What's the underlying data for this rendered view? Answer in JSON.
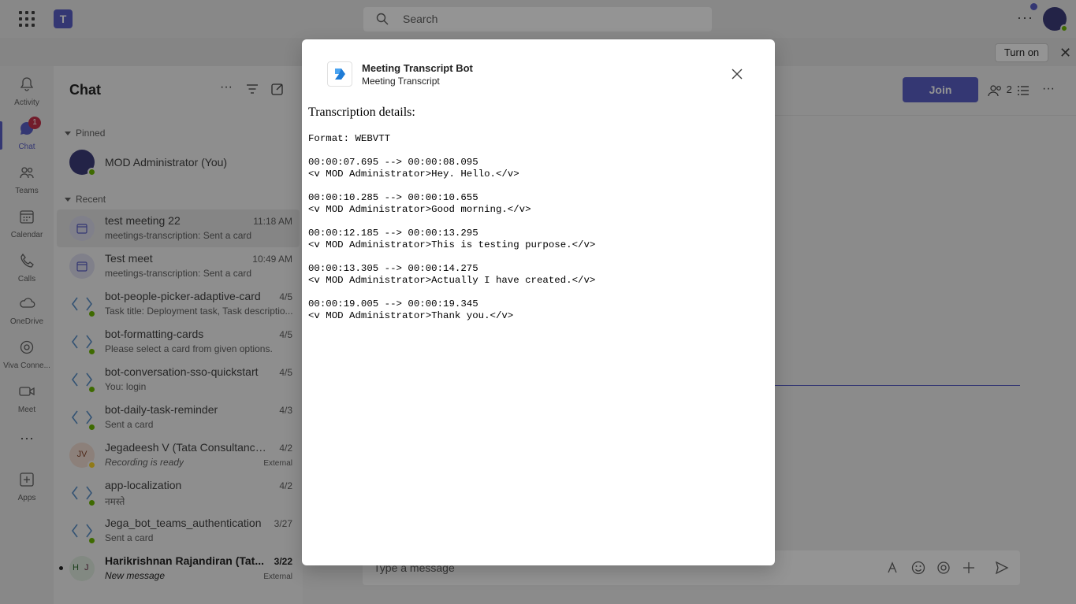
{
  "topbar": {
    "search_placeholder": "Search"
  },
  "banner": {
    "turn_on_label": "Turn on"
  },
  "rail": {
    "items": [
      {
        "label": "Activity",
        "icon": "bell-icon"
      },
      {
        "label": "Chat",
        "icon": "chat-icon",
        "badge": "1"
      },
      {
        "label": "Teams",
        "icon": "teams-icon"
      },
      {
        "label": "Calendar",
        "icon": "calendar-icon"
      },
      {
        "label": "Calls",
        "icon": "phone-icon"
      },
      {
        "label": "OneDrive",
        "icon": "cloud-icon"
      },
      {
        "label": "Viva Conne...",
        "icon": "viva-icon"
      },
      {
        "label": "Meet",
        "icon": "video-icon"
      },
      {
        "label": "Apps",
        "icon": "apps-icon"
      }
    ]
  },
  "chatlist": {
    "title": "Chat",
    "pinned_label": "Pinned",
    "recent_label": "Recent",
    "pinned": [
      {
        "name": "MOD Administrator (You)"
      }
    ],
    "recent": [
      {
        "name": "test meeting 22",
        "time": "11:18 AM",
        "preview": "meetings-transcription: Sent a card"
      },
      {
        "name": "Test meet",
        "time": "10:49 AM",
        "preview": "meetings-transcription: Sent a card"
      },
      {
        "name": "bot-people-picker-adaptive-card",
        "time": "4/5",
        "preview": "Task title: Deployment task, Task descriptio..."
      },
      {
        "name": "bot-formatting-cards",
        "time": "4/5",
        "preview": "Please select a card from given options."
      },
      {
        "name": "bot-conversation-sso-quickstart",
        "time": "4/5",
        "preview": "You: login"
      },
      {
        "name": "bot-daily-task-reminder",
        "time": "4/3",
        "preview": "Sent a card"
      },
      {
        "name": "Jegadeesh V (Tata Consultancy ...",
        "time": "4/2",
        "preview": "Recording is ready",
        "initials": "JV",
        "external": "External"
      },
      {
        "name": "app-localization",
        "time": "4/2",
        "preview": "नमस्ते"
      },
      {
        "name": "Jega_bot_teams_authentication",
        "time": "3/27",
        "preview": "Sent a card"
      },
      {
        "name": "Harikrishnan Rajandiran (Tat...",
        "time": "3/22",
        "preview": "New message",
        "initials_a": "H",
        "initials_b": "J",
        "external": "External"
      }
    ]
  },
  "main": {
    "join_label": "Join",
    "participant_count": "2",
    "composer_placeholder": "Type a message"
  },
  "dialog": {
    "app_name": "Meeting Transcript Bot",
    "app_subtitle": "Meeting Transcript",
    "heading": "Transcription details:",
    "transcript": "Format: WEBVTT\n\n00:00:07.695 --> 00:00:08.095\n<v MOD Administrator>Hey. Hello.</v>\n\n00:00:10.285 --> 00:00:10.655\n<v MOD Administrator>Good morning.</v>\n\n00:00:12.185 --> 00:00:13.295\n<v MOD Administrator>This is testing purpose.</v>\n\n00:00:13.305 --> 00:00:14.275\n<v MOD Administrator>Actually I have created.</v>\n\n00:00:19.005 --> 00:00:19.345\n<v MOD Administrator>Thank you.</v>"
  },
  "colors": {
    "brand": "#5b5fc7",
    "available": "#6bb700",
    "badge": "#c4314b"
  }
}
